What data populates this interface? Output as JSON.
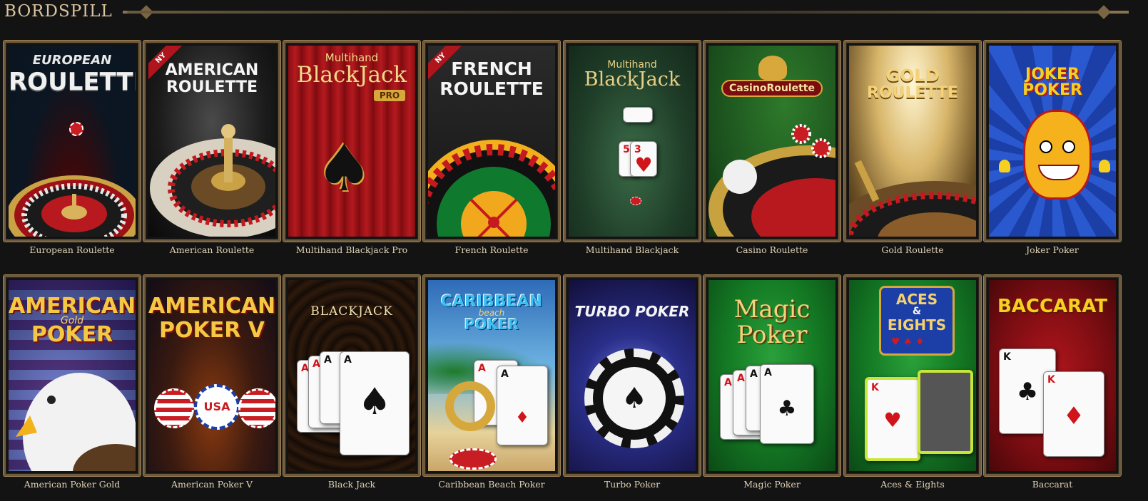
{
  "section": {
    "title": "BORDSPILL"
  },
  "games": [
    {
      "label": "European Roulette",
      "art_title_1": "EUROPEAN",
      "art_title_2": "ROULETTE",
      "badge": ""
    },
    {
      "label": "American Roulette",
      "art_title_1": "AMERICAN",
      "art_title_2": "ROULETTE",
      "badge": "NY"
    },
    {
      "label": "Multihand Blackjack Pro",
      "art_title_1": "Multihand",
      "art_title_2": "BlackJack",
      "art_title_3": "PRO",
      "badge": ""
    },
    {
      "label": "French Roulette",
      "art_title_1": "FRENCH",
      "art_title_2": "ROULETTE",
      "badge": "NY"
    },
    {
      "label": "Multihand Blackjack",
      "art_title_1": "Multihand",
      "art_title_2": "BlackJack",
      "badge": ""
    },
    {
      "label": "Casino Roulette",
      "art_title_1": "CasinoRoulette",
      "badge": ""
    },
    {
      "label": "Gold Roulette",
      "art_title_1": "GOLD",
      "art_title_2": "ROULETTE",
      "badge": ""
    },
    {
      "label": "Joker Poker",
      "art_title_1": "JOKER",
      "art_title_2": "POKER",
      "badge": ""
    },
    {
      "label": "American Poker Gold",
      "art_title_1": "AMERICAN",
      "art_title_2": "Gold",
      "art_title_3": "POKER",
      "badge": ""
    },
    {
      "label": "American Poker V",
      "art_title_1": "AMERICAN",
      "art_title_2": "POKER V",
      "art_title_3": "USA",
      "badge": ""
    },
    {
      "label": "Black Jack",
      "art_title_1": "BLACKJACK",
      "badge": ""
    },
    {
      "label": "Caribbean Beach Poker",
      "art_title_1": "CARIBBEAN",
      "art_title_2": "beach",
      "art_title_3": "POKER",
      "badge": ""
    },
    {
      "label": "Turbo Poker",
      "art_title_1": "TURBO POKER",
      "badge": ""
    },
    {
      "label": "Magic Poker",
      "art_title_1": "Magic",
      "art_title_2": "Poker",
      "badge": ""
    },
    {
      "label": "Aces & Eights",
      "art_title_1": "ACES",
      "art_title_2": "&",
      "art_title_3": "EIGHTS",
      "badge": ""
    },
    {
      "label": "Baccarat",
      "art_title_1": "BACCARAT",
      "badge": ""
    }
  ],
  "colors": {
    "background": "#131313",
    "frame": "#6e5a3c",
    "label_text": "#ded0b4",
    "title_text": "#d9c4a0"
  }
}
